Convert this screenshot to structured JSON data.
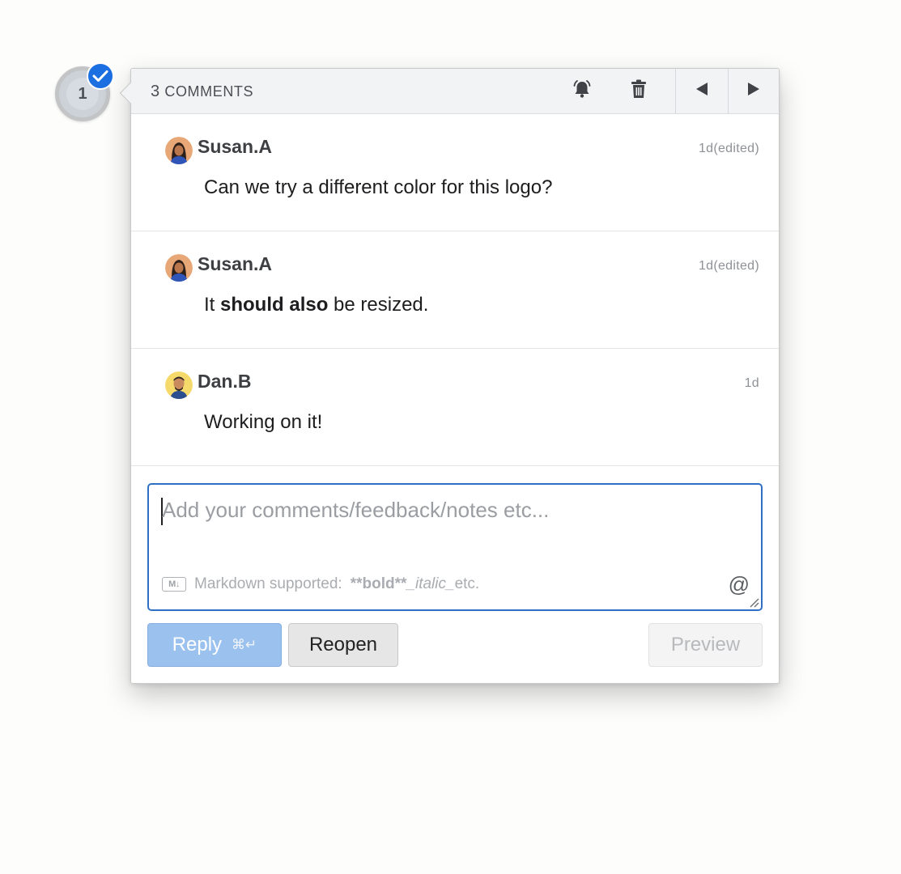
{
  "pin": {
    "number": "1",
    "resolved": true
  },
  "header": {
    "count_number": "3",
    "count_label": "COMMENTS",
    "icons": [
      "alarm-bell-icon",
      "trash-icon",
      "previous-arrow-icon",
      "next-arrow-icon"
    ]
  },
  "comments": [
    {
      "author": "Susan.A",
      "time": "1d(edited)",
      "text_plain": "Can we try a different color for this logo?",
      "avatar": "susan-avatar"
    },
    {
      "author": "Susan.A",
      "time": "1d(edited)",
      "text_pre": "It ",
      "text_bold": "should also",
      "text_post": " be resized.",
      "avatar": "susan-avatar"
    },
    {
      "author": "Dan.B",
      "time": "1d",
      "text_plain": "Working on it!",
      "avatar": "dan-avatar"
    }
  ],
  "editor": {
    "placeholder": "Add your comments/feedback/notes etc...",
    "md_label": "Markdown supported:",
    "md_bold": "**bold**",
    "md_italic": "_italic_",
    "md_etc": "etc.",
    "mention_symbol": "@"
  },
  "buttons": {
    "reply": "Reply",
    "reply_shortcut": "⌘↵",
    "reopen": "Reopen",
    "preview": "Preview"
  },
  "colors": {
    "accent": "#2f6fc4",
    "check_badge": "#1b6fe0",
    "reply_bg": "#9bc1ee"
  }
}
